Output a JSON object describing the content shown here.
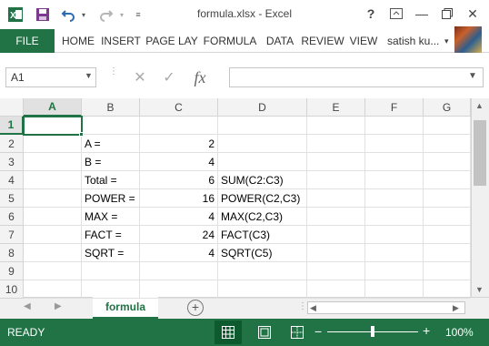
{
  "window": {
    "title": "formula.xlsx - Excel",
    "help_label": "?",
    "minimize_label": "—",
    "close_label": "✕"
  },
  "quick_access": {
    "excel_icon": "excel-logo-icon",
    "save_icon": "save-icon",
    "undo_icon": "undo-icon",
    "redo_icon": "redo-icon"
  },
  "ribbon": {
    "file_label": "FILE",
    "tabs": [
      "HOME",
      "INSERT",
      "PAGE LAY",
      "FORMULA",
      "DATA",
      "REVIEW",
      "VIEW"
    ],
    "user_name": "satish ku..."
  },
  "formula_bar": {
    "name_box": "A1",
    "fx_label": "fx",
    "formula": ""
  },
  "grid": {
    "columns": [
      "A",
      "B",
      "C",
      "D",
      "E",
      "F",
      "G"
    ],
    "rows": [
      {
        "row": "1",
        "B": "",
        "C": "",
        "D": ""
      },
      {
        "row": "2",
        "B": "A    =",
        "C": "2",
        "D": ""
      },
      {
        "row": "3",
        "B": "B    =",
        "C": "4",
        "D": ""
      },
      {
        "row": "4",
        "B": "Total  =",
        "C": "6",
        "D": "SUM(C2:C3)"
      },
      {
        "row": "5",
        "B": "POWER =",
        "C": "16",
        "D": "POWER(C2,C3)"
      },
      {
        "row": "6",
        "B": "MAX =",
        "C": "4",
        "D": "MAX(C2,C3)"
      },
      {
        "row": "7",
        "B": "FACT =",
        "C": "24",
        "D": "FACT(C3)"
      },
      {
        "row": "8",
        "B": "SQRT =",
        "C": "4",
        "D": "SQRT(C5)"
      },
      {
        "row": "9",
        "B": "",
        "C": "",
        "D": ""
      },
      {
        "row": "10",
        "B": "",
        "C": "",
        "D": ""
      }
    ]
  },
  "sheets": {
    "active": "formula",
    "add_label": "+"
  },
  "status": {
    "ready": "READY",
    "zoom": "100%",
    "zoom_minus": "−",
    "zoom_plus": "+"
  },
  "colors": {
    "accent": "#217346"
  }
}
